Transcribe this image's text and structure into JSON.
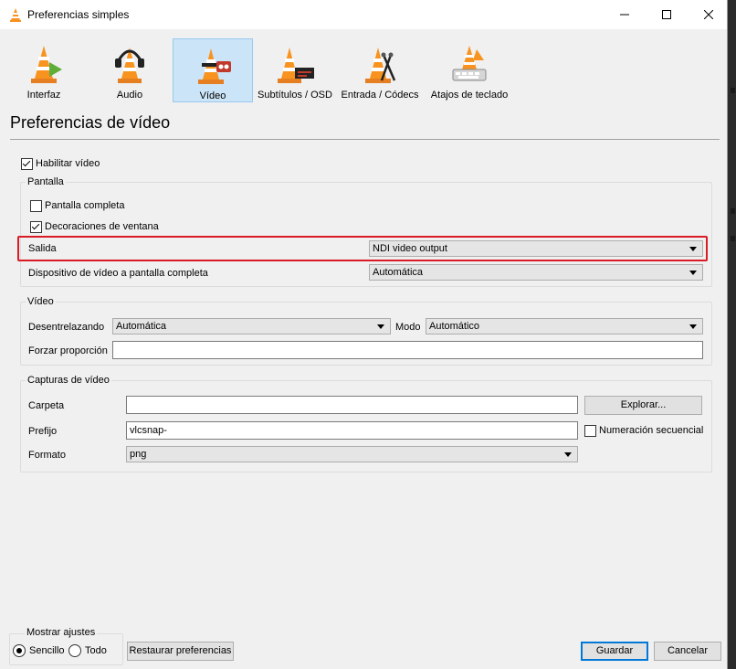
{
  "window": {
    "title": "Preferencias simples"
  },
  "toolbar": {
    "items": [
      {
        "label": "Interfaz",
        "icon": "interface-cone-icon"
      },
      {
        "label": "Audio",
        "icon": "audio-headphones-cone-icon"
      },
      {
        "label": "Vídeo",
        "icon": "video-cone-icon",
        "active": true
      },
      {
        "label": "Subtítulos / OSD",
        "icon": "subtitles-cone-icon"
      },
      {
        "label": "Entrada / Códecs",
        "icon": "input-codecs-cone-icon"
      },
      {
        "label": "Atajos de teclado",
        "icon": "hotkeys-cone-icon"
      }
    ]
  },
  "page": {
    "heading": "Preferencias de vídeo"
  },
  "enable_video": {
    "label": "Habilitar vídeo",
    "checked": true
  },
  "pantalla": {
    "title": "Pantalla",
    "fullscreen": {
      "label": "Pantalla completa",
      "checked": false
    },
    "decorations": {
      "label": "Decoraciones de ventana",
      "checked": true
    },
    "output": {
      "label": "Salida",
      "value": "NDI video output"
    },
    "fullscreen_device": {
      "label": "Dispositivo de vídeo a pantalla completa",
      "value": "Automática"
    }
  },
  "video": {
    "title": "Vídeo",
    "deinterlace": {
      "label": "Desentrelazando",
      "value": "Automática"
    },
    "mode": {
      "label": "Modo",
      "value": "Automático"
    },
    "aspect": {
      "label": "Forzar proporción",
      "value": ""
    }
  },
  "snapshots": {
    "title": "Capturas de vídeo",
    "folder": {
      "label": "Carpeta",
      "value": ""
    },
    "browse_label": "Explorar...",
    "prefix": {
      "label": "Prefijo",
      "value": "vlcsnap-"
    },
    "sequential": {
      "label": "Numeración secuencial",
      "checked": false
    },
    "format": {
      "label": "Formato",
      "value": "png"
    }
  },
  "show_settings": {
    "title": "Mostrar ajustes",
    "simple": {
      "label": "Sencillo",
      "checked": true
    },
    "all": {
      "label": "Todo",
      "checked": false
    }
  },
  "footer": {
    "reset_label": "Restaurar preferencias",
    "save_label": "Guardar",
    "cancel_label": "Cancelar"
  },
  "colors": {
    "highlight": "#d81b24",
    "accent": "#0078d7",
    "cone_orange": "#f7931e"
  }
}
